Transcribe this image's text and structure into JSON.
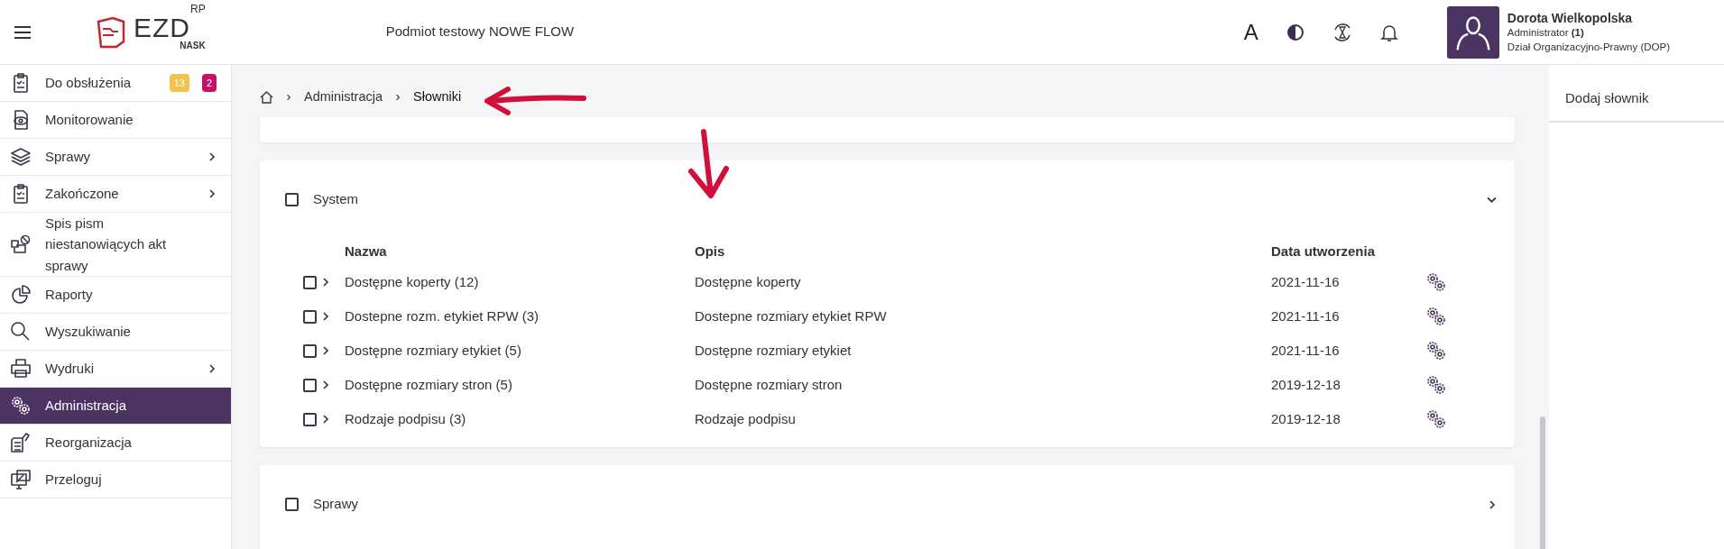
{
  "header": {
    "logo": {
      "text": "EZD",
      "superscript": "RP",
      "subtitle": "NASK"
    },
    "subject": "Podmiot testowy NOWE FLOW",
    "font_button": "A",
    "user": {
      "name": "Dorota Wielkopolska",
      "role": "Administrator **(1)**",
      "department": "Dział Organizacyjno-Prawny (DOP)"
    }
  },
  "sidebar": {
    "items": [
      {
        "label": "Do obsłużenia",
        "selected": false,
        "has_submenu": false,
        "badges": [
          {
            "text": "13",
            "color": "#f2c14e"
          },
          {
            "text": "2",
            "color": "#c4126b"
          }
        ]
      },
      {
        "label": "Monitorowanie",
        "selected": false,
        "has_submenu": false
      },
      {
        "label": "Sprawy",
        "selected": false,
        "has_submenu": true
      },
      {
        "label": "Zakończone",
        "selected": false,
        "has_submenu": true
      },
      {
        "label": "Spis pism niestanowiących akt sprawy",
        "selected": false,
        "has_submenu": false
      },
      {
        "label": "Raporty",
        "selected": false,
        "has_submenu": false
      },
      {
        "label": "Wyszukiwanie",
        "selected": false,
        "has_submenu": false
      },
      {
        "label": "Wydruki",
        "selected": false,
        "has_submenu": true
      },
      {
        "label": "Administracja",
        "selected": true,
        "has_submenu": false
      },
      {
        "label": "Reorganizacja",
        "selected": false,
        "has_submenu": false
      },
      {
        "label": "Przeloguj",
        "selected": false,
        "has_submenu": false
      }
    ]
  },
  "breadcrumb": [
    "Administracja",
    "Słowniki"
  ],
  "groups": [
    {
      "title": "System",
      "checked": false,
      "expanded": true,
      "columns": [
        "Nazwa",
        "Opis",
        "Data utworzenia"
      ],
      "rows": [
        {
          "name": "Dostępne koperty (12)",
          "description": "Dostępne koperty",
          "created": "2021-11-16",
          "checked": false
        },
        {
          "name": "Dostepne rozm. etykiet RPW (3)",
          "description": "Dostepne rozmiary etykiet RPW",
          "created": "2021-11-16",
          "checked": false
        },
        {
          "name": "Dostępne rozmiary etykiet (5)",
          "description": "Dostępne rozmiary etykiet",
          "created": "2021-11-16",
          "checked": false
        },
        {
          "name": "Dostępne rozmiary stron (5)",
          "description": "Dostępne rozmiary stron",
          "created": "2019-12-18",
          "checked": false
        },
        {
          "name": "Rodzaje podpisu (3)",
          "description": "Rodzaje podpisu",
          "created": "2019-12-18",
          "checked": false
        }
      ]
    },
    {
      "title": "Sprawy",
      "checked": false,
      "expanded": false
    }
  ],
  "right_panel": {
    "actions": [
      "Dodaj słownik"
    ]
  }
}
